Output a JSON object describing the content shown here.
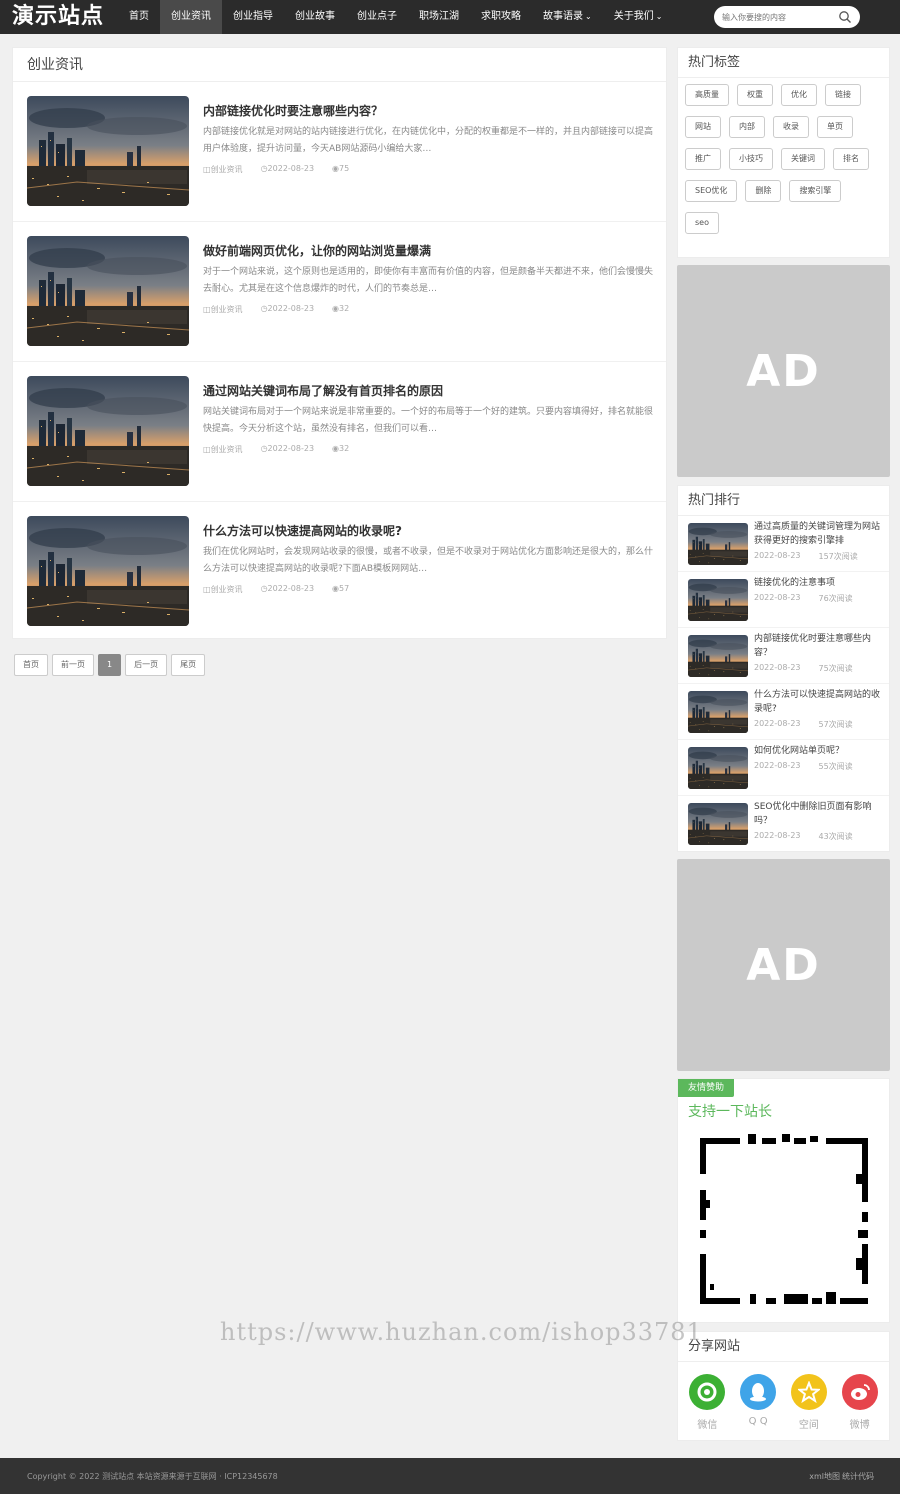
{
  "header": {
    "logo": "演示站点",
    "nav": [
      "首页",
      "创业资讯",
      "创业指导",
      "创业故事",
      "创业点子",
      "职场江湖",
      "求职攻略",
      "故事语录",
      "关于我们"
    ],
    "nav_active_index": 1,
    "search_placeholder": "输入你要搜的内容"
  },
  "main": {
    "heading": "创业资讯",
    "posts": [
      {
        "title": "内部链接优化时要注意哪些内容？",
        "excerpt": "内部链接优化就是对网站的站内链接进行优化，在内链优化中，分配的权重都是不一样的，并且内部链接可以提高用户体验度，提升访问量，今天AB网站源码小编给大家…",
        "category": "创业资讯",
        "date": "2022-08-23",
        "views": "75"
      },
      {
        "title": "做好前端网页优化，让你的网站浏览量爆满",
        "excerpt": "对于一个网站来说，这个原则也是适用的，即使你有丰富而有价值的内容，但是颜备半天都进不来，他们会慢慢失去耐心。尤其是在这个信息爆炸的时代，人们的节奏总是…",
        "category": "创业资讯",
        "date": "2022-08-23",
        "views": "32"
      },
      {
        "title": "通过网站关键词布局了解没有首页排名的原因",
        "excerpt": "网站关键词布局对于一个网站来说是非常重要的。一个好的布局等于一个好的建筑。只要内容填得好，排名就能很快提高。今天分析这个站，虽然没有排名，但我们可以看…",
        "category": "创业资讯",
        "date": "2022-08-23",
        "views": "32"
      },
      {
        "title": "什么方法可以快速提高网站的收录呢?",
        "excerpt": "我们在优化网站时，会发现网站收录的很慢，或者不收录，但是不收录对于网站优化方面影响还是很大的，那么什么方法可以快速提高网站的收录呢?下面AB模板网网站…",
        "category": "创业资讯",
        "date": "2022-08-23",
        "views": "57"
      }
    ],
    "pagination": [
      "首页",
      "前一页",
      "1",
      "后一页",
      "尾页"
    ],
    "current_page": "1"
  },
  "sidebar": {
    "tags_heading": "热门标签",
    "tags": [
      "高质量",
      "权重",
      "优化",
      "链接",
      "网站",
      "内部",
      "收录",
      "单页",
      "推广",
      "小技巧",
      "关键词",
      "排名",
      "SEO优化",
      "删除",
      "搜索引擎",
      "seo"
    ],
    "ad_text": "AD",
    "rank_heading": "热门排行",
    "rank": [
      {
        "title": "通过高质量的关键词管理为网站获得更好的搜索引擎排",
        "date": "2022-08-23",
        "views": "157次阅读"
      },
      {
        "title": "链接优化的注意事项",
        "date": "2022-08-23",
        "views": "76次阅读"
      },
      {
        "title": "内部链接优化时要注意哪些内容？",
        "date": "2022-08-23",
        "views": "75次阅读"
      },
      {
        "title": "什么方法可以快速提高网站的收录呢?",
        "date": "2022-08-23",
        "views": "57次阅读"
      },
      {
        "title": "如何优化网站单页呢？",
        "date": "2022-08-23",
        "views": "55次阅读"
      },
      {
        "title": "SEO优化中删除旧页面有影响吗？",
        "date": "2022-08-23",
        "views": "43次阅读"
      }
    ],
    "sponsor_label": "友情赞助",
    "sponsor_title": "支持一下站长",
    "share_heading": "分享网站",
    "share": [
      {
        "label": "微信",
        "icon": "wechat-icon",
        "color": "#3cb034"
      },
      {
        "label": "Q Q",
        "icon": "qq-icon",
        "color": "#3fa4e8"
      },
      {
        "label": "空间",
        "icon": "qzone-star-icon",
        "color": "#f2c31b"
      },
      {
        "label": "微博",
        "icon": "weibo-icon",
        "color": "#e6454c"
      }
    ]
  },
  "watermark": "https://www.huzhan.com/ishop33781",
  "footer": {
    "copyright": "Copyright © 2022 测试站点 本站资源来源于互联网 · ICP12345678",
    "links": [
      "xml地图",
      "统计代码"
    ]
  },
  "colors": {
    "topbar": "#2b2b2b",
    "accent_green": "#5cb85c",
    "ad_gray": "#cacaca"
  }
}
